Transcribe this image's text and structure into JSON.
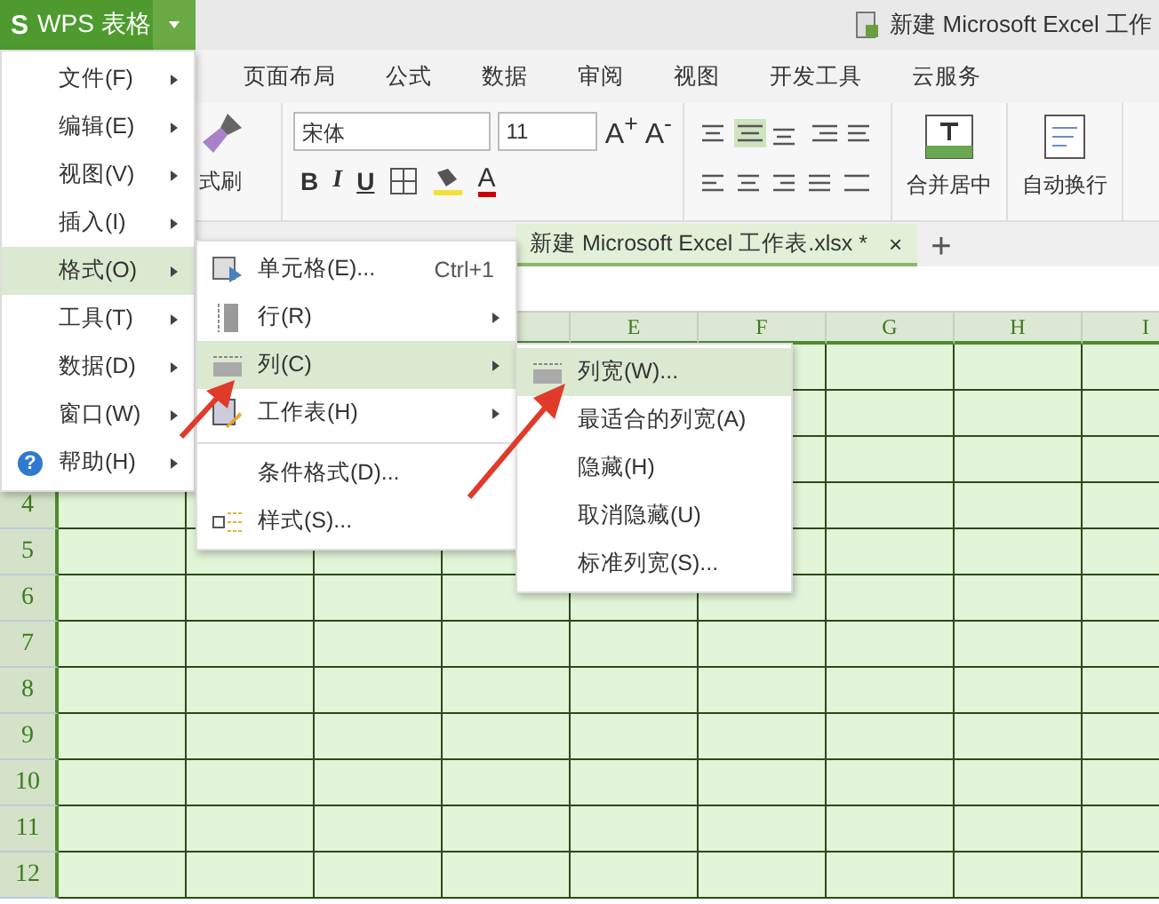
{
  "app_button": {
    "label": "WPS 表格",
    "logo": "S"
  },
  "title": "新建 Microsoft Excel 工作",
  "ribbon_tabs": [
    "页面布局",
    "公式",
    "数据",
    "审阅",
    "视图",
    "开发工具",
    "云服务"
  ],
  "toolbar": {
    "format_painter": "式刷",
    "font": "宋体",
    "font_size": "11",
    "grow": "A$^{+}$",
    "shrink": "A$^{-}$",
    "styles": [
      "B",
      "I",
      "U"
    ],
    "font_color": "A",
    "merge": "合并居中",
    "wrap": "自动换行"
  },
  "doc_tab": {
    "label": "新建 Microsoft Excel 工作表.xlsx *",
    "close": "×"
  },
  "new_tab": "+",
  "column_headers": [
    "E",
    "F",
    "G",
    "H",
    "I"
  ],
  "row_numbers": [
    "4",
    "5",
    "6",
    "7",
    "8",
    "9",
    "10",
    "11",
    "12"
  ],
  "main_menu": [
    {
      "label": "文件(F)",
      "selected": false,
      "kind": "plain"
    },
    {
      "label": "编辑(E)",
      "selected": false,
      "kind": "plain"
    },
    {
      "label": "视图(V)",
      "selected": false,
      "kind": "plain"
    },
    {
      "label": "插入(I)",
      "selected": false,
      "kind": "plain"
    },
    {
      "label": "格式(O)",
      "selected": true,
      "kind": "plain"
    },
    {
      "label": "工具(T)",
      "selected": false,
      "kind": "plain"
    },
    {
      "label": "数据(D)",
      "selected": false,
      "kind": "plain"
    },
    {
      "label": "窗口(W)",
      "selected": false,
      "kind": "plain"
    },
    {
      "label": "帮助(H)",
      "selected": false,
      "kind": "help",
      "icon": "?"
    }
  ],
  "format_menu": [
    {
      "label": "单元格(E)...",
      "shortcut": "Ctrl+1",
      "has_submenu": false,
      "selected": false,
      "kind": "cell",
      "separator_before": false
    },
    {
      "label": "行(R)",
      "has_submenu": true,
      "selected": false,
      "kind": "row",
      "separator_before": false
    },
    {
      "label": "列(C)",
      "has_submenu": true,
      "selected": true,
      "kind": "column",
      "separator_before": false
    },
    {
      "label": "工作表(H)",
      "has_submenu": true,
      "selected": false,
      "kind": "sheet",
      "separator_before": false
    },
    {
      "label": "条件格式(D)...",
      "has_submenu": false,
      "selected": false,
      "kind": "plain",
      "separator_before": true
    },
    {
      "label": "样式(S)...",
      "has_submenu": false,
      "selected": false,
      "kind": "style",
      "separator_before": false
    }
  ],
  "column_menu": [
    {
      "label": "列宽(W)...",
      "selected": true,
      "kind": "width"
    },
    {
      "label": "最适合的列宽(A)",
      "selected": false,
      "kind": "plain"
    },
    {
      "label": "隐藏(H)",
      "selected": false,
      "kind": "plain"
    },
    {
      "label": "取消隐藏(U)",
      "selected": false,
      "kind": "plain"
    },
    {
      "label": "标准列宽(S)...",
      "selected": false,
      "kind": "plain"
    }
  ]
}
